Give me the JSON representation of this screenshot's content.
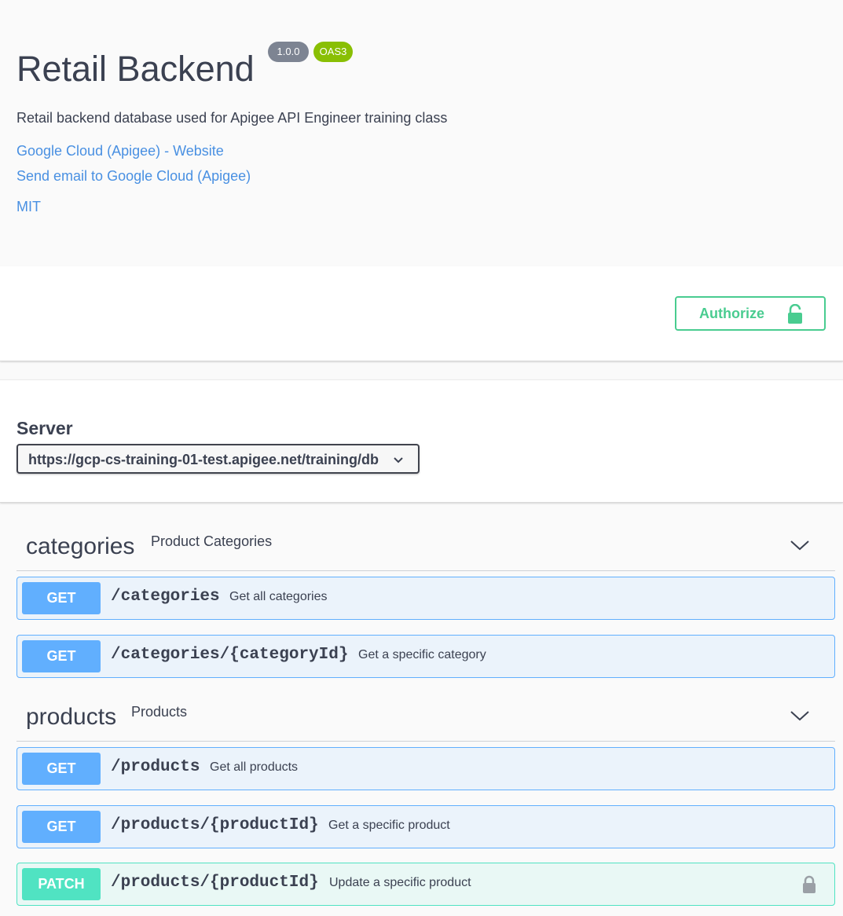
{
  "info": {
    "title": "Retail Backend",
    "version": "1.0.0",
    "oas_badge": "OAS3",
    "description": "Retail backend database used for Apigee API Engineer training class",
    "links": {
      "website": "Google Cloud (Apigee) - Website",
      "email": "Send email to Google Cloud (Apigee)",
      "license": "MIT"
    }
  },
  "scheme": {
    "authorize_label": "Authorize"
  },
  "servers": {
    "label": "Server",
    "selected": "https://gcp-cs-training-01-test.apigee.net/training/db"
  },
  "tags": [
    {
      "name": "categories",
      "description": "Product Categories",
      "operations": [
        {
          "method": "GET",
          "path": "/categories",
          "summary": "Get all categories"
        },
        {
          "method": "GET",
          "path": "/categories/{categoryId}",
          "summary": "Get a specific category"
        }
      ]
    },
    {
      "name": "products",
      "description": "Products",
      "operations": [
        {
          "method": "GET",
          "path": "/products",
          "summary": "Get all products"
        },
        {
          "method": "GET",
          "path": "/products/{productId}",
          "summary": "Get a specific product"
        },
        {
          "method": "PATCH",
          "path": "/products/{productId}",
          "summary": "Update a specific product"
        }
      ]
    }
  ],
  "colors": {
    "get": "#61affe",
    "patch": "#50e3c2",
    "authorize": "#49cc90",
    "link": "#4990e2",
    "version_badge": "#7d8492",
    "oas_badge": "#89bf04"
  }
}
